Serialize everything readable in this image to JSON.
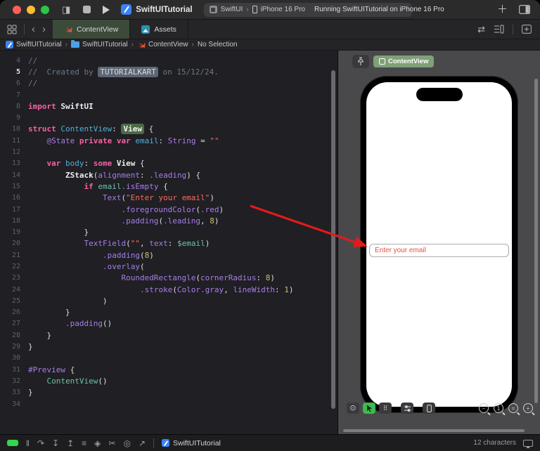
{
  "titlebar": {
    "window_title": "SwiftUITutorial",
    "scheme_label": "SwiftUI",
    "destination": "iPhone 16 Pro",
    "status": "Running SwiftUITutorial on iPhone 16 Pro"
  },
  "tabbar": {
    "tabs": [
      {
        "label": "ContentView",
        "active": true
      },
      {
        "label": "Assets",
        "active": false
      }
    ]
  },
  "jumpbar": {
    "items": [
      {
        "label": "SwiftUITutorial",
        "icon": "app-icon"
      },
      {
        "label": "SwiftUITutorial",
        "icon": "folder-icon"
      },
      {
        "label": "ContentView",
        "icon": "swift-icon"
      },
      {
        "label": "No Selection",
        "icon": null
      }
    ]
  },
  "editor": {
    "token_colors": {
      "c": {
        "color": "#6C7986"
      },
      "k": {
        "color": "#FC5FA3",
        "bold": true
      },
      "p": {
        "color": "#DFDFE0"
      },
      "pb": {
        "color": "#EDEDEF",
        "bold": true
      },
      "d": {
        "color": "#54AFD6"
      },
      "m": {
        "color": "#A97DE8"
      },
      "t": {
        "color": "#6FC2A8"
      },
      "s": {
        "color": "#FC6A5D"
      },
      "n": {
        "color": "#D0BF69"
      },
      "sel": {
        "color": "#D6DAE0",
        "bg": "#5D6674"
      },
      "badge": {
        "color": "#F2F5F0",
        "bg": "#4C6A45",
        "bold": true
      }
    },
    "lines": [
      {
        "n": 4,
        "tokens": [
          [
            "c",
            "//"
          ]
        ]
      },
      {
        "n": 5,
        "cur": true,
        "tokens": [
          [
            "c",
            "//  Created by "
          ],
          [
            "sel",
            "TUTORIALKART"
          ],
          [
            "c",
            " on 15/12/24."
          ]
        ]
      },
      {
        "n": 6,
        "tokens": [
          [
            "c",
            "//"
          ]
        ]
      },
      {
        "n": 7,
        "tokens": []
      },
      {
        "n": 8,
        "tokens": [
          [
            "k",
            "import "
          ],
          [
            "pb",
            "SwiftUI"
          ]
        ]
      },
      {
        "n": 9,
        "tokens": []
      },
      {
        "n": 10,
        "tokens": [
          [
            "k",
            "struct "
          ],
          [
            "d",
            "ContentView"
          ],
          [
            "p",
            ": "
          ],
          [
            "badge",
            "View"
          ],
          [
            "p",
            " {"
          ]
        ]
      },
      {
        "n": 11,
        "tokens": [
          [
            "p",
            "    "
          ],
          [
            "m",
            "@State"
          ],
          [
            "p",
            " "
          ],
          [
            "k",
            "private"
          ],
          [
            "p",
            " "
          ],
          [
            "k",
            "var"
          ],
          [
            "p",
            " "
          ],
          [
            "d",
            "email"
          ],
          [
            "p",
            ": "
          ],
          [
            "m",
            "String"
          ],
          [
            "p",
            " = "
          ],
          [
            "s",
            "\"\""
          ]
        ]
      },
      {
        "n": 12,
        "tokens": []
      },
      {
        "n": 13,
        "tokens": [
          [
            "p",
            "    "
          ],
          [
            "k",
            "var"
          ],
          [
            "p",
            " "
          ],
          [
            "d",
            "body"
          ],
          [
            "p",
            ": "
          ],
          [
            "k",
            "some"
          ],
          [
            "p",
            " "
          ],
          [
            "pb",
            "View"
          ],
          [
            "p",
            " {"
          ]
        ]
      },
      {
        "n": 14,
        "tokens": [
          [
            "p",
            "        "
          ],
          [
            "pb",
            "ZStack"
          ],
          [
            "p",
            "("
          ],
          [
            "m",
            "alignment"
          ],
          [
            "p",
            ": "
          ],
          [
            "m",
            ".leading"
          ],
          [
            "p",
            ") {"
          ]
        ]
      },
      {
        "n": 15,
        "tokens": [
          [
            "p",
            "            "
          ],
          [
            "k",
            "if"
          ],
          [
            "p",
            " "
          ],
          [
            "t",
            "email"
          ],
          [
            "m",
            ".isEmpty"
          ],
          [
            "p",
            " {"
          ]
        ]
      },
      {
        "n": 16,
        "tokens": [
          [
            "p",
            "                "
          ],
          [
            "m",
            "Text"
          ],
          [
            "p",
            "("
          ],
          [
            "s",
            "\"Enter your email\""
          ],
          [
            "p",
            ")"
          ]
        ]
      },
      {
        "n": 17,
        "tokens": [
          [
            "p",
            "                    "
          ],
          [
            "m",
            ".foregroundColor"
          ],
          [
            "p",
            "("
          ],
          [
            "m",
            ".red"
          ],
          [
            "p",
            ")"
          ]
        ]
      },
      {
        "n": 18,
        "tokens": [
          [
            "p",
            "                    "
          ],
          [
            "m",
            ".padding"
          ],
          [
            "p",
            "("
          ],
          [
            "m",
            ".leading"
          ],
          [
            "p",
            ", "
          ],
          [
            "n",
            "8"
          ],
          [
            "p",
            ")"
          ]
        ]
      },
      {
        "n": 19,
        "tokens": [
          [
            "p",
            "            }"
          ]
        ]
      },
      {
        "n": 20,
        "tokens": [
          [
            "p",
            "            "
          ],
          [
            "m",
            "TextField"
          ],
          [
            "p",
            "("
          ],
          [
            "s",
            "\"\""
          ],
          [
            "p",
            ", "
          ],
          [
            "m",
            "text"
          ],
          [
            "p",
            ": "
          ],
          [
            "t",
            "$email"
          ],
          [
            "p",
            ")"
          ]
        ]
      },
      {
        "n": 21,
        "tokens": [
          [
            "p",
            "                "
          ],
          [
            "m",
            ".padding"
          ],
          [
            "p",
            "("
          ],
          [
            "n",
            "8"
          ],
          [
            "p",
            ")"
          ]
        ]
      },
      {
        "n": 22,
        "tokens": [
          [
            "p",
            "                "
          ],
          [
            "m",
            ".overlay"
          ],
          [
            "p",
            "("
          ]
        ]
      },
      {
        "n": 23,
        "tokens": [
          [
            "p",
            "                    "
          ],
          [
            "m",
            "RoundedRectangle"
          ],
          [
            "p",
            "("
          ],
          [
            "m",
            "cornerRadius"
          ],
          [
            "p",
            ": "
          ],
          [
            "n",
            "8"
          ],
          [
            "p",
            ")"
          ]
        ]
      },
      {
        "n": 24,
        "tokens": [
          [
            "p",
            "                        "
          ],
          [
            "m",
            ".stroke"
          ],
          [
            "p",
            "("
          ],
          [
            "m",
            "Color"
          ],
          [
            "m",
            ".gray"
          ],
          [
            "p",
            ", "
          ],
          [
            "m",
            "lineWidth"
          ],
          [
            "p",
            ": "
          ],
          [
            "n",
            "1"
          ],
          [
            "p",
            ")"
          ]
        ]
      },
      {
        "n": 25,
        "tokens": [
          [
            "p",
            "                )"
          ]
        ]
      },
      {
        "n": 26,
        "tokens": [
          [
            "p",
            "        }"
          ]
        ]
      },
      {
        "n": 27,
        "tokens": [
          [
            "p",
            "        "
          ],
          [
            "m",
            ".padding"
          ],
          [
            "p",
            "()"
          ]
        ]
      },
      {
        "n": 28,
        "tokens": [
          [
            "p",
            "    }"
          ]
        ]
      },
      {
        "n": 29,
        "tokens": [
          [
            "p",
            "}"
          ]
        ]
      },
      {
        "n": 30,
        "tokens": []
      },
      {
        "n": 31,
        "tokens": [
          [
            "m",
            "#Preview"
          ],
          [
            "p",
            " {"
          ]
        ]
      },
      {
        "n": 32,
        "tokens": [
          [
            "p",
            "    "
          ],
          [
            "t",
            "ContentView"
          ],
          [
            "p",
            "()"
          ]
        ]
      },
      {
        "n": 33,
        "tokens": [
          [
            "p",
            "}"
          ]
        ]
      },
      {
        "n": 34,
        "tokens": []
      }
    ]
  },
  "canvas": {
    "preview_badge_label": "ContentView",
    "textfield_text": "Enter your email",
    "zoom_buttons": {
      "out": "–",
      "actual": "1",
      "fit": "=",
      "in": "+"
    }
  },
  "statusbar": {
    "app_label": "SwiftUITutorial",
    "char_count": "12 characters"
  },
  "glyphs": {
    "sidebar_toggle": "◨",
    "back": "‹",
    "forward": "›",
    "chevron": "›",
    "grid": "⊞",
    "swap": "⇄",
    "plus": "＋",
    "pause": "‖",
    "step_over": "↷",
    "step_into": "↧",
    "step_out": "↥",
    "view_hierarchy": "≡",
    "memory_graph": "◈",
    "environment_overrides": "✂",
    "instruments": "◎",
    "simulate_location": "↗",
    "live_preview": "⊙",
    "variants": "⠿"
  },
  "colors": {
    "editor_bg": "#1F1F24",
    "canvas_bg": "#49494C",
    "chrome_bg": "#2B2B2C",
    "active_tab_bg": "#3C4A3A",
    "arrow_red": "#E01B1B",
    "placeholder_red": "#EC4B3C",
    "swift_orange": "#F05138",
    "xcode_blue": "#3B82F7",
    "run_green": "#32D74B",
    "selection_bg": "#5D6674",
    "view_badge_bg": "#4C6A45"
  }
}
